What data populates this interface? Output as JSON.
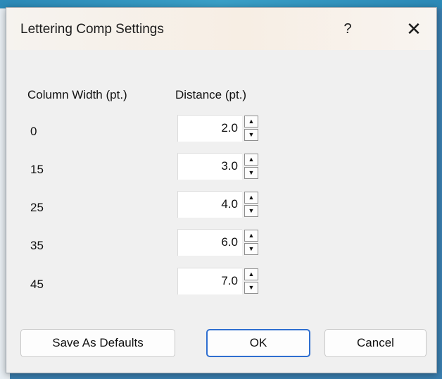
{
  "dialog": {
    "title": "Lettering Comp Settings",
    "help_label": "?",
    "close_label": "✕"
  },
  "table": {
    "column_width_header": "Column Width (pt.)",
    "distance_header": "Distance (pt.)",
    "rows": [
      {
        "column_width": "0",
        "distance": "2.0"
      },
      {
        "column_width": "15",
        "distance": "3.0"
      },
      {
        "column_width": "25",
        "distance": "4.0"
      },
      {
        "column_width": "35",
        "distance": "6.0"
      },
      {
        "column_width": "45",
        "distance": "7.0"
      }
    ]
  },
  "buttons": {
    "save_defaults": "Save As Defaults",
    "ok": "OK",
    "cancel": "Cancel"
  },
  "icons": {
    "spin_up": "▲",
    "spin_down": "▼"
  }
}
